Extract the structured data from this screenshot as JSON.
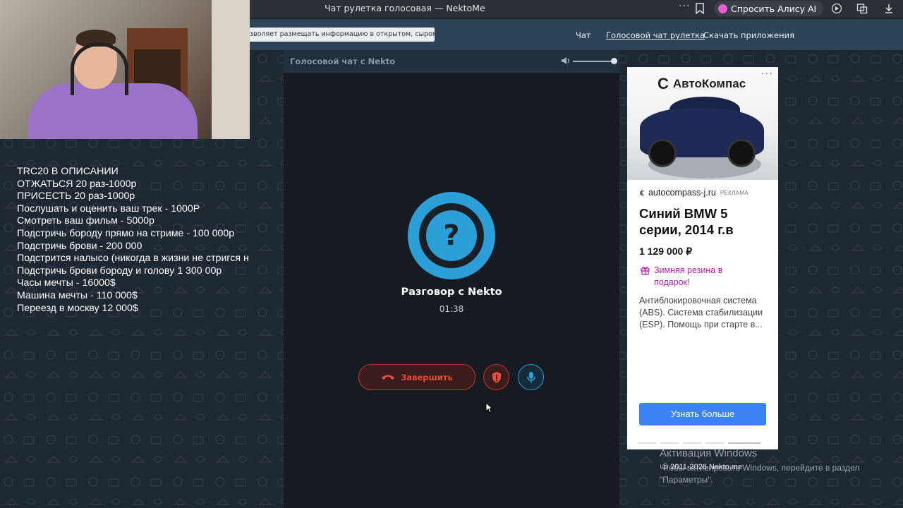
{
  "browser": {
    "title": "Чат рулетка голосовая — NektoMe",
    "dots": "···",
    "alisa_label": "Спросить Алису AI"
  },
  "header": {
    "notice": "зволяет размещать информацию в открытом, сыром виде!",
    "nav": [
      "Чат",
      "Голосовой чат рулетка",
      "Скачать приложения"
    ]
  },
  "donations": [
    "TRC20 В ОПИСАНИИ",
    "ОТЖАТЬСЯ 20 раз-1000р",
    "ПРИСЕСТЬ 20 раз-1000р",
    "Послушать и оценить ваш трек - 1000Р",
    "Смотреть ваш фильм - 5000р",
    "Подстричь бороду прямо на стриме - 100 000р",
    "Подстричь брови - 200 000",
    "Подстрится налысо (никогда в жизни не стригся н",
    "Подстричь брови бороду и голову 1 300 00р",
    "Часы мечты - 16000$",
    "Машина мечты - 110 000$",
    "Переезд в москву 12 000$"
  ],
  "chat": {
    "panel_title": "Голосовой чат с Nekto",
    "volume_level": 1.0,
    "avatar_symbol": "?",
    "title": "Разговор с Nekto",
    "timer": "01:38",
    "end_label": "Завершить"
  },
  "ad": {
    "brand": "АвтоКомпас",
    "brand_mark": "C",
    "more": "···",
    "domain": "autocompass-j.ru",
    "tag": "РЕКЛАМА",
    "title": "Синий BMW 5 серии, 2014 г.в",
    "price": "1 129 000 ₽",
    "gift": "Зимняя резина в подарок!",
    "description": "Антиблокировочная система (ABS). Система стабилизации (ESP). Помощь при старте в...",
    "button": "Узнать больше",
    "slide_active": 5,
    "slide_count": 5
  },
  "footer": {
    "windows_activate": "Активация Windows",
    "windows_hint": "Чтобы активировать Windows, перейдите в раздел \"Параметры\".",
    "copyright": "© 2011-2026 Nekto.me"
  },
  "colors": {
    "accent_blue": "#2c9fd9",
    "danger_red": "#c0392b",
    "header_bg": "#2d4358",
    "panel_bg": "#161b21",
    "ad_button": "#3b82f6",
    "ad_gift": "#b11ea8"
  }
}
